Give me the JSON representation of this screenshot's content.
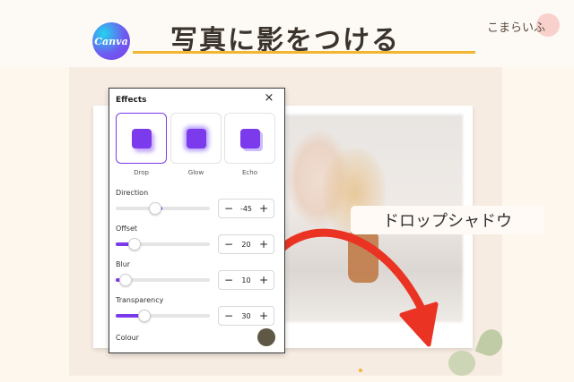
{
  "header": {
    "logo_text": "Canva",
    "title": "写真に影をつける",
    "brand": "こまらいふ"
  },
  "annotation": {
    "label": "ドロップシャドウ"
  },
  "panel": {
    "title": "Effects",
    "effects": [
      {
        "label": "Drop",
        "selected": true
      },
      {
        "label": "Glow",
        "selected": false
      },
      {
        "label": "Echo",
        "selected": false
      }
    ],
    "controls": [
      {
        "label": "Direction",
        "value": "-45",
        "slider_fraction": 0.42,
        "fill_from_center": true
      },
      {
        "label": "Offset",
        "value": "20",
        "slider_fraction": 0.2
      },
      {
        "label": "Blur",
        "value": "10",
        "slider_fraction": 0.1
      },
      {
        "label": "Transparency",
        "value": "30",
        "slider_fraction": 0.3
      }
    ],
    "colour_label": "Colour",
    "colour_value": "#5f5845"
  },
  "colors": {
    "accent": "#7c3aed",
    "arrow": "#ea3323",
    "underline": "#f2b632"
  },
  "icons": {
    "close": "×",
    "minus": "−",
    "plus": "+"
  }
}
